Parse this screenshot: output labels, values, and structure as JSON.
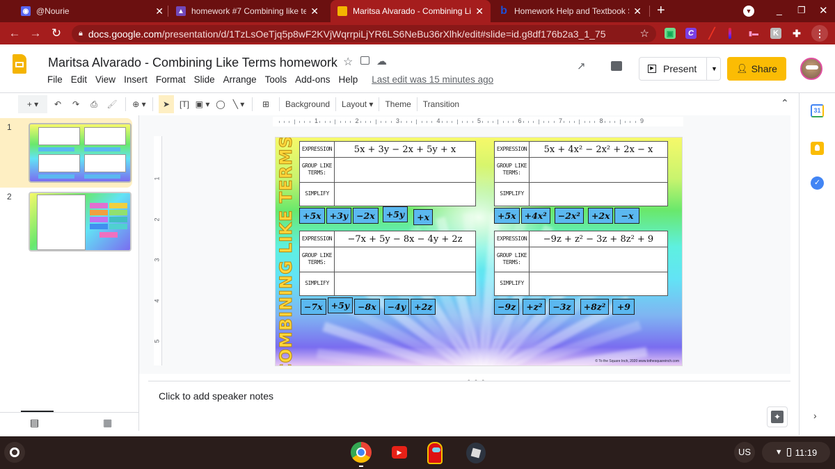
{
  "browser": {
    "tabs": [
      {
        "title": "@Nourie",
        "icon": "discord-icon",
        "active": false
      },
      {
        "title": "homework #7 Combining like ter",
        "icon": "classroom-icon",
        "active": false
      },
      {
        "title": "Maritsa Alvarado - Combining Lik",
        "icon": "slides-icon",
        "active": true
      },
      {
        "title": "Homework Help and Textbook So",
        "icon": "bartleby-icon",
        "active": false
      }
    ],
    "new_tab_label": "+",
    "url_domain": "docs.google.com",
    "url_path": "/presentation/d/1TzLsOeTjq5p8wF2KVjWqrrpiLjYR6LS6NeBu36rXlhk/edit#slide=id.g8df176b2a3_1_75",
    "extensions": [
      "screencastify-icon",
      "canva-icon",
      "marker-icon",
      "color-bar-icon",
      "nyan-icon",
      "kami-icon",
      "puzzle-icon"
    ]
  },
  "app": {
    "title": "Maritsa Alvarado - Combining Like Terms homework",
    "menu": [
      "File",
      "Edit",
      "View",
      "Insert",
      "Format",
      "Slide",
      "Arrange",
      "Tools",
      "Add-ons",
      "Help"
    ],
    "last_edit": "Last edit was 15 minutes ago",
    "present_label": "Present",
    "share_label": "Share",
    "toolbar": {
      "background": "Background",
      "layout": "Layout",
      "theme": "Theme",
      "transition": "Transition"
    }
  },
  "ruler": {
    "h_ticks": [
      "1",
      "2",
      "3",
      "4",
      "5",
      "6",
      "7",
      "8",
      "9"
    ],
    "v_ticks": [
      "1",
      "2",
      "3",
      "4",
      "5"
    ]
  },
  "filmstrip": {
    "slides": [
      {
        "number": "1",
        "selected": true
      },
      {
        "number": "2",
        "selected": false
      }
    ]
  },
  "slide": {
    "side_title": "COMBINING LIKE TERMS",
    "row_labels": {
      "expression": "EXPRESSION",
      "group": "GROUP LIKE TERMS:",
      "simplify": "SIMPLIFY"
    },
    "problems": [
      {
        "expression": "5x + 3y − 2x + 5y + x",
        "tiles": [
          "+5x",
          "+3y",
          "−2x",
          "+5y",
          "+x"
        ]
      },
      {
        "expression": "5x + 4x² − 2x² + 2x − x",
        "tiles": [
          "+5x",
          "+4x²",
          "−2x²",
          "+2x",
          "−x"
        ]
      },
      {
        "expression": "−7x + 5y − 8x − 4y + 2z",
        "tiles": [
          "−7x",
          "+5y",
          "−8x",
          "−4y",
          "+2z"
        ]
      },
      {
        "expression": "−9z + z² − 3z + 8z² + 9",
        "tiles": [
          "−9z",
          "+z²",
          "−3z",
          "+8z²",
          "+9"
        ]
      }
    ],
    "copyright": "© To the Square Inch, 2020 www.tothesquareinch.com"
  },
  "notes": {
    "placeholder": "Click to add speaker notes"
  },
  "shelf": {
    "apps": [
      "chrome-icon",
      "youtube-icon",
      "among-us-icon",
      "roblox-icon"
    ],
    "ime": "US",
    "time": "11:19"
  }
}
